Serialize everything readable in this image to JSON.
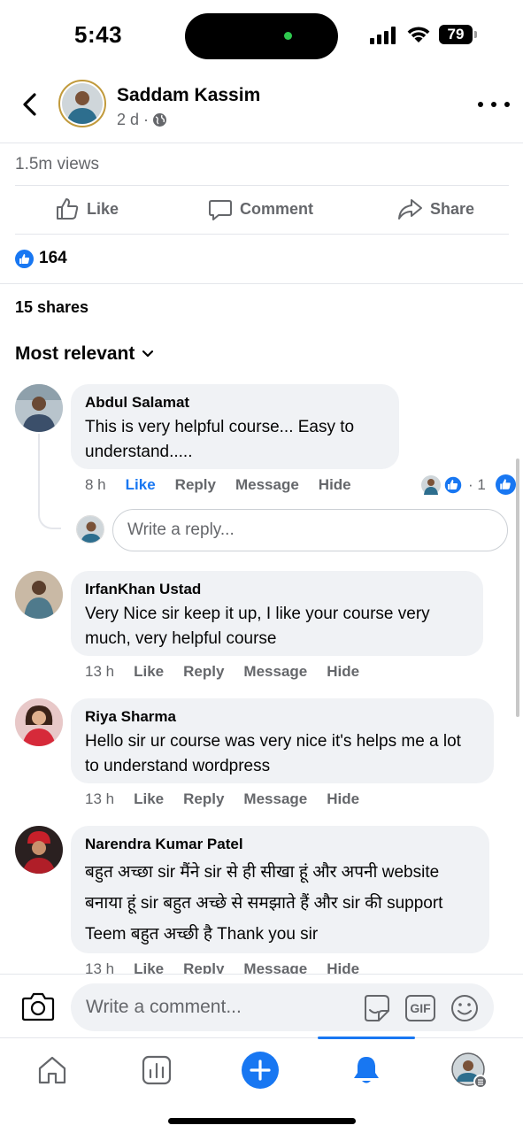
{
  "status_bar": {
    "time": "5:43",
    "battery": "79"
  },
  "header": {
    "name": "Saddam Kassim",
    "meta": "2 d ·"
  },
  "post": {
    "views": "1.5m views",
    "actions": {
      "like": "Like",
      "comment": "Comment",
      "share": "Share"
    },
    "reaction_count": "164",
    "shares": "15 shares",
    "sort_label": "Most relevant"
  },
  "comments": [
    {
      "name": "Abdul Salamat",
      "text": "This is very helpful course... Easy to understand.....",
      "time": "8 h",
      "like": "Like",
      "reply": "Reply",
      "message": "Message",
      "hide": "Hide",
      "reaction_summary": "· 1"
    },
    {
      "name": "IrfanKhan Ustad",
      "text": "Very Nice sir keep it up, I like your course very much, very helpful course",
      "time": "13 h",
      "like": "Like",
      "reply": "Reply",
      "message": "Message",
      "hide": "Hide"
    },
    {
      "name": "Riya Sharma",
      "text": "Hello sir ur course was very nice it's helps me a lot to understand wordpress",
      "time": "13 h",
      "like": "Like",
      "reply": "Reply",
      "message": "Message",
      "hide": "Hide"
    },
    {
      "name": "Narendra Kumar Patel",
      "text": "बहुत अच्छा sir मैंने sir से ही सीखा हूं और अपनी website बनाया हूं sir बहुत अच्छे से समझाते हैं और sir की support Teem बहुत अच्छी है Thank you sir",
      "time": "13 h",
      "like": "Like",
      "reply": "Reply",
      "message": "Message",
      "hide": "Hide"
    }
  ],
  "reply_placeholder": "Write a reply...",
  "comment_placeholder": "Write a comment...",
  "icons": {
    "back": "chevron-left-icon",
    "more": "more-horizontal-icon",
    "globe": "globe-icon",
    "camera": "camera-icon",
    "sticker": "sticker-icon",
    "gif": "gif-icon",
    "emoji": "emoji-icon",
    "tabs": [
      "home-icon",
      "dashboard-icon",
      "create-icon",
      "notifications-icon",
      "profile-icon"
    ]
  },
  "gif_label": "GIF",
  "colors": {
    "accent": "#1877f2",
    "secondary_text": "#65676b",
    "bubble": "#f0f2f5"
  }
}
